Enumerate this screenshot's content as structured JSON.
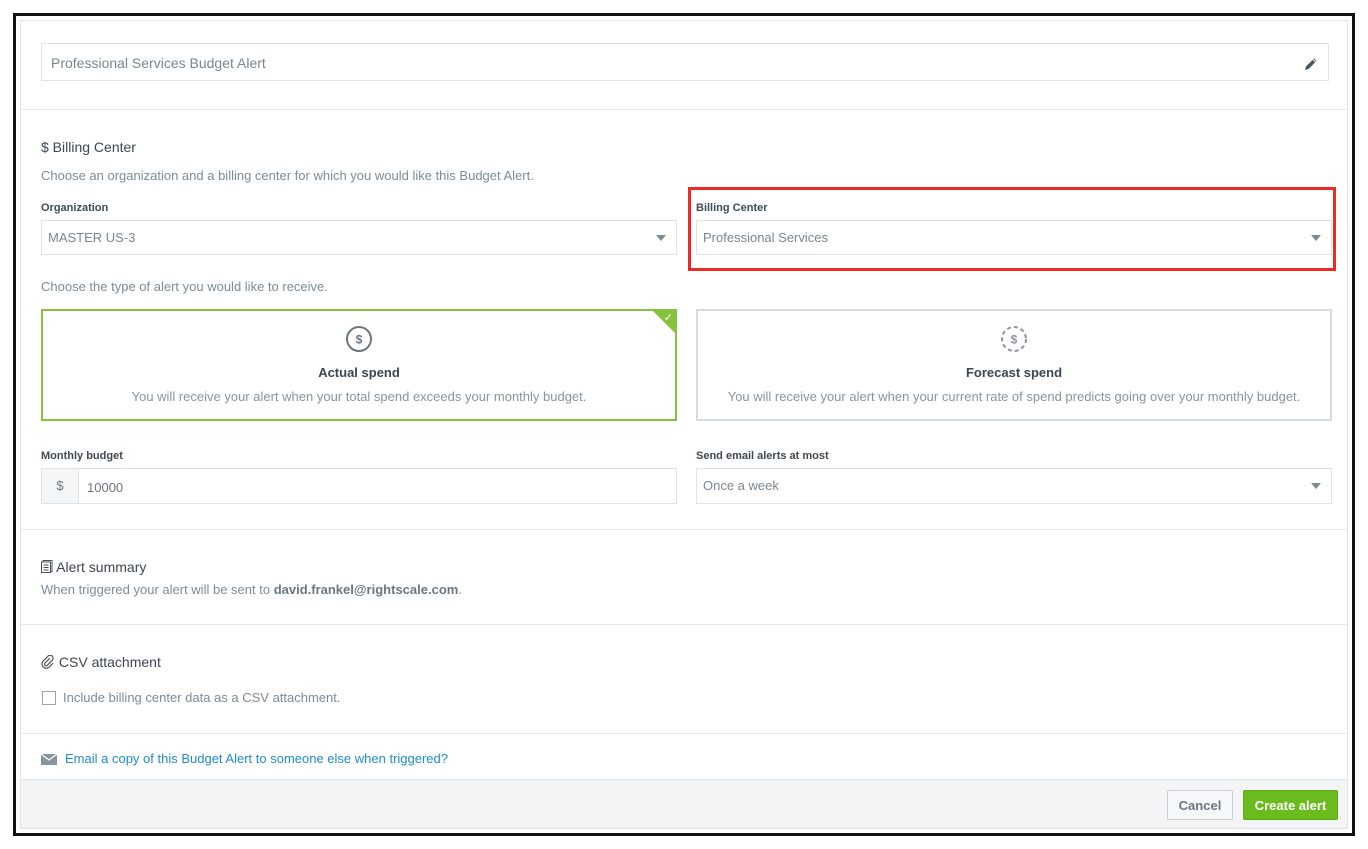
{
  "alert_name": "Professional Services Budget Alert",
  "billing_section": {
    "title": "$ Billing Center",
    "help": "Choose an organization and a billing center for which you would like this Budget Alert.",
    "organization_label": "Organization",
    "organization_value": "MASTER US-3",
    "billing_center_label": "Billing Center",
    "billing_center_value": "Professional Services"
  },
  "alert_type": {
    "help": "Choose the type of alert you would like to receive.",
    "actual": {
      "title": "Actual spend",
      "description": "You will receive your alert when your total spend exceeds your monthly budget.",
      "selected": true
    },
    "forecast": {
      "title": "Forecast spend",
      "description": "You will receive your alert when your current rate of spend predicts going over your monthly budget.",
      "selected": false
    }
  },
  "budget": {
    "label": "Monthly budget",
    "prefix": "$",
    "value": "10000"
  },
  "frequency": {
    "label": "Send email alerts at most",
    "value": "Once a week"
  },
  "summary": {
    "title": "Alert summary",
    "text": "When triggered your alert will be sent to",
    "email": "david.frankel@rightscale.com",
    "end": "."
  },
  "csv": {
    "title": "CSV attachment",
    "checkbox_label": "Include billing center data as a CSV attachment.",
    "checked": false
  },
  "email_copy_link": "Email a copy of this Budget Alert to someone else when triggered?",
  "footer": {
    "cancel_label": "Cancel",
    "create_label": "Create alert"
  },
  "colors": {
    "selected_border": "#86c23c",
    "highlight": "#ec2b26",
    "link": "#1f8ccc",
    "primary_button": "#6bbb1f"
  }
}
